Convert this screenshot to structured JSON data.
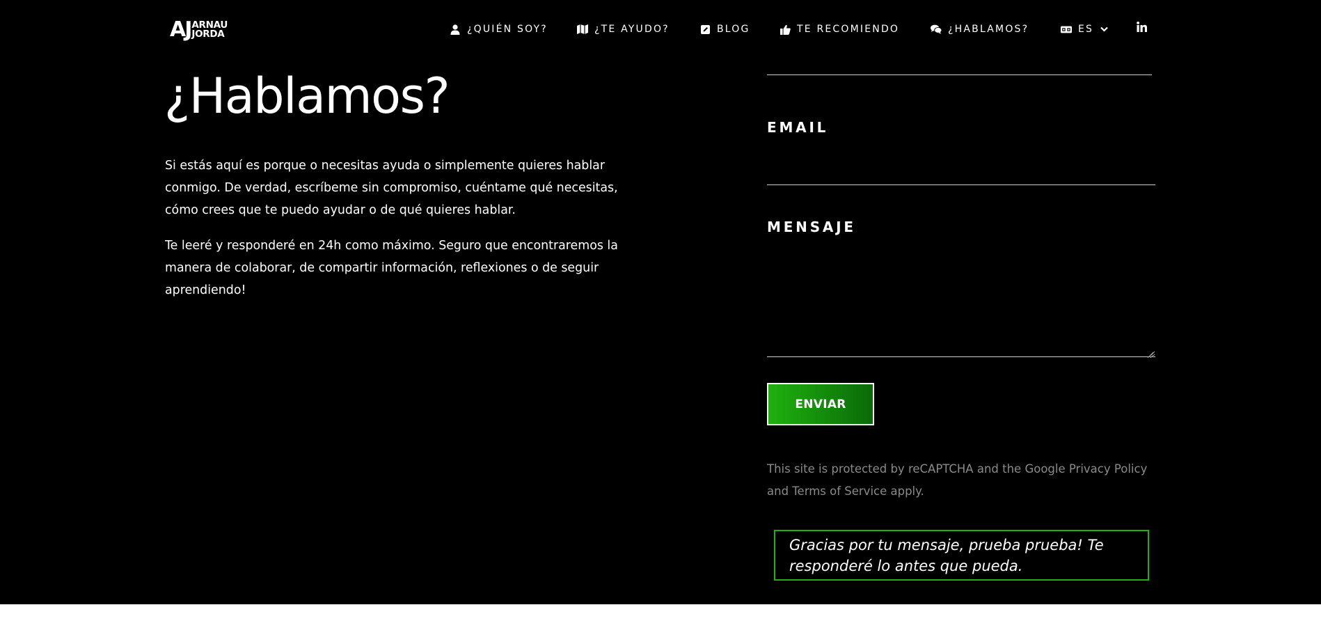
{
  "brand": {
    "monogram": "AJ",
    "name_line1": "ARNAU",
    "name_line2": "JORDA"
  },
  "nav": {
    "items": [
      {
        "label": "¿QUIÉN SOY?",
        "icon": "user-icon"
      },
      {
        "label": "¿TE AYUDO?",
        "icon": "map-icon"
      },
      {
        "label": "BLOG",
        "icon": "edit-icon"
      },
      {
        "label": "TE RECOMIENDO",
        "icon": "thumbs-up-icon"
      },
      {
        "label": "¿HABLAMOS?",
        "icon": "chat-icon"
      }
    ],
    "language": {
      "label": "ES",
      "icon": "language-icon"
    },
    "social": {
      "icon": "linkedin-icon"
    }
  },
  "main": {
    "title": "¿Hablamos?",
    "paragraphs": [
      "Si estás aquí es porque o necesitas ayuda o simplemente quieres hablar conmigo. De verdad, escríbeme sin compromiso, cuéntame qué necesitas, cómo crees que te puedo ayudar o de qué quieres hablar.",
      "Te leeré y responderé en 24h como máximo. Seguro que encontraremos la manera de colaborar, de compartir información, reflexiones o de seguir aprendiendo!"
    ]
  },
  "form": {
    "email_label": "EMAIL",
    "email_value": "",
    "message_label": "MENSAJE",
    "message_value": "",
    "submit_label": "ENVIAR",
    "recaptcha_notice": "This site is protected by reCAPTCHA and the Google Privacy Policy and Terms of Service apply.",
    "success_message": "Gracias por tu mensaje, prueba prueba! Te responderé lo antes que pueda."
  },
  "colors": {
    "background": "#000000",
    "accent": "#1fb10f",
    "muted_text": "#8a8a8a"
  }
}
